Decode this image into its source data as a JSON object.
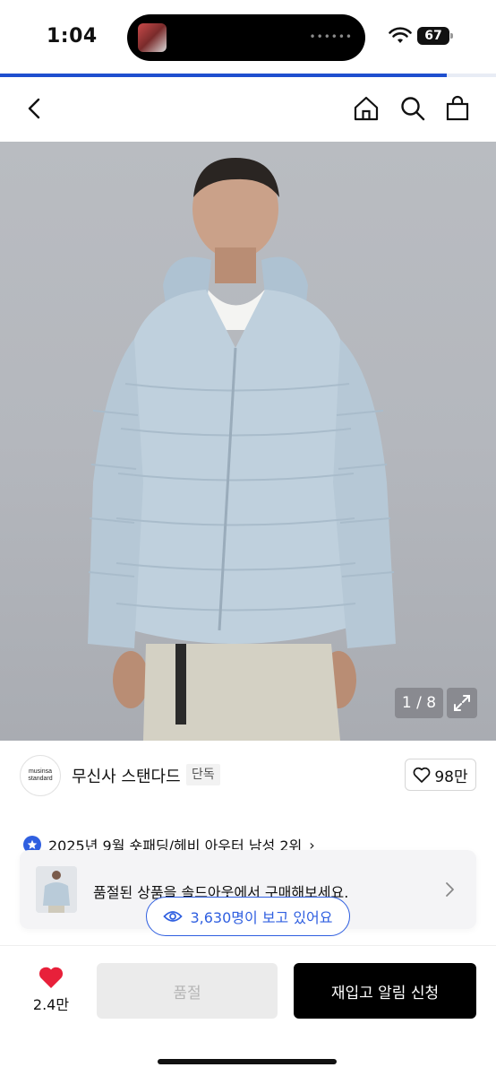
{
  "status_bar": {
    "time": "1:04",
    "battery": "67",
    "load_progress_percent": 90
  },
  "nav": {
    "icons": [
      "back-icon",
      "home-icon",
      "search-icon",
      "shopping-bag-icon"
    ]
  },
  "gallery": {
    "counter": "1 / 8"
  },
  "brand": {
    "logo_line1": "musinsa",
    "logo_line2": "standard",
    "name": "무신사 스탠다드",
    "badge": "단독",
    "like_count": "98만"
  },
  "ranking": {
    "text": "2025년 9월 숏패딩/헤비 아우터 남성 2위",
    "chevron": "›"
  },
  "soldout_banner": {
    "text": "품절된 상품을 솔드아웃에서 구매해보세요."
  },
  "viewers": {
    "text": "3,630명이 보고 있어요"
  },
  "bottom_bar": {
    "wish_count": "2.4만",
    "soldout_label": "품절",
    "restock_label": "재입고 알림 신청"
  },
  "colors": {
    "accent": "#2f5fe0",
    "heart": "#e8203a",
    "primary_button": "#000000"
  }
}
